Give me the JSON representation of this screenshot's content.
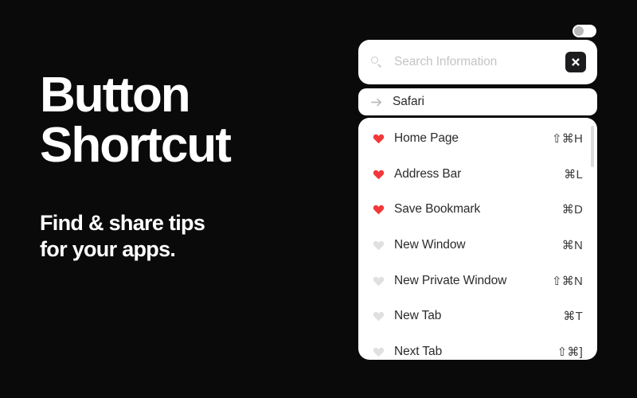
{
  "background_color": "#0a0a0a",
  "promo": {
    "title": "Button\nShortcut",
    "subtitle": "Find & share tips\nfor your apps."
  },
  "toggle": {
    "name": "power-toggle",
    "state": "off"
  },
  "search": {
    "icon": "search-icon",
    "value": "",
    "placeholder": "Search Information",
    "action_button_icon": "command-expand-icon"
  },
  "app_row": {
    "icon": "arrow-right-icon",
    "label": "Safari"
  },
  "shortcut_list": {
    "favorite_color": "#f2383a",
    "inactive_color": "#e0e0e2",
    "items": [
      {
        "icon": "heart-icon",
        "label": "Home Page",
        "shortcut": "⇧⌘H",
        "favorite": true
      },
      {
        "icon": "heart-icon",
        "label": "Address Bar",
        "shortcut": "⌘L",
        "favorite": true
      },
      {
        "icon": "heart-icon",
        "label": "Save Bookmark",
        "shortcut": "⌘D",
        "favorite": true
      },
      {
        "icon": "heart-icon",
        "label": "New Window",
        "shortcut": "⌘N",
        "favorite": false
      },
      {
        "icon": "heart-icon",
        "label": "New Private Window",
        "shortcut": "⇧⌘N",
        "favorite": false
      },
      {
        "icon": "heart-icon",
        "label": "New Tab",
        "shortcut": "⌘T",
        "favorite": false
      },
      {
        "icon": "heart-icon",
        "label": "Next Tab",
        "shortcut": "⇧⌘]",
        "favorite": false
      }
    ]
  }
}
